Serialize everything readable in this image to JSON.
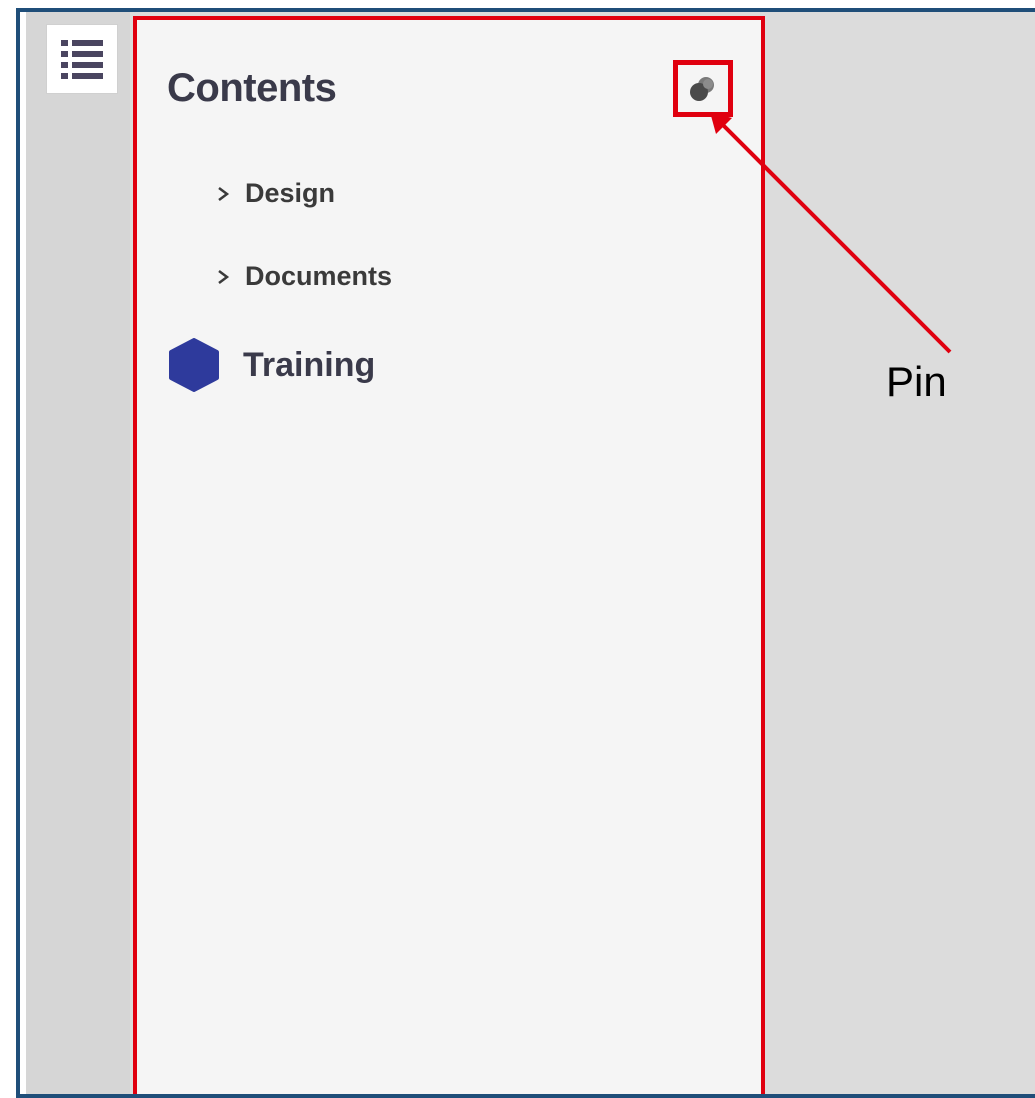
{
  "panel": {
    "title": "Contents",
    "items": [
      {
        "label": "Design",
        "type": "folder"
      },
      {
        "label": "Documents",
        "type": "folder"
      },
      {
        "label": "Training",
        "type": "module"
      }
    ]
  },
  "annotation": {
    "label": "Pin",
    "color": "#e0000f"
  },
  "colors": {
    "frame_border": "#1f4e79",
    "panel_bg": "#f5f5f5",
    "module_icon": "#2e3a9c"
  }
}
